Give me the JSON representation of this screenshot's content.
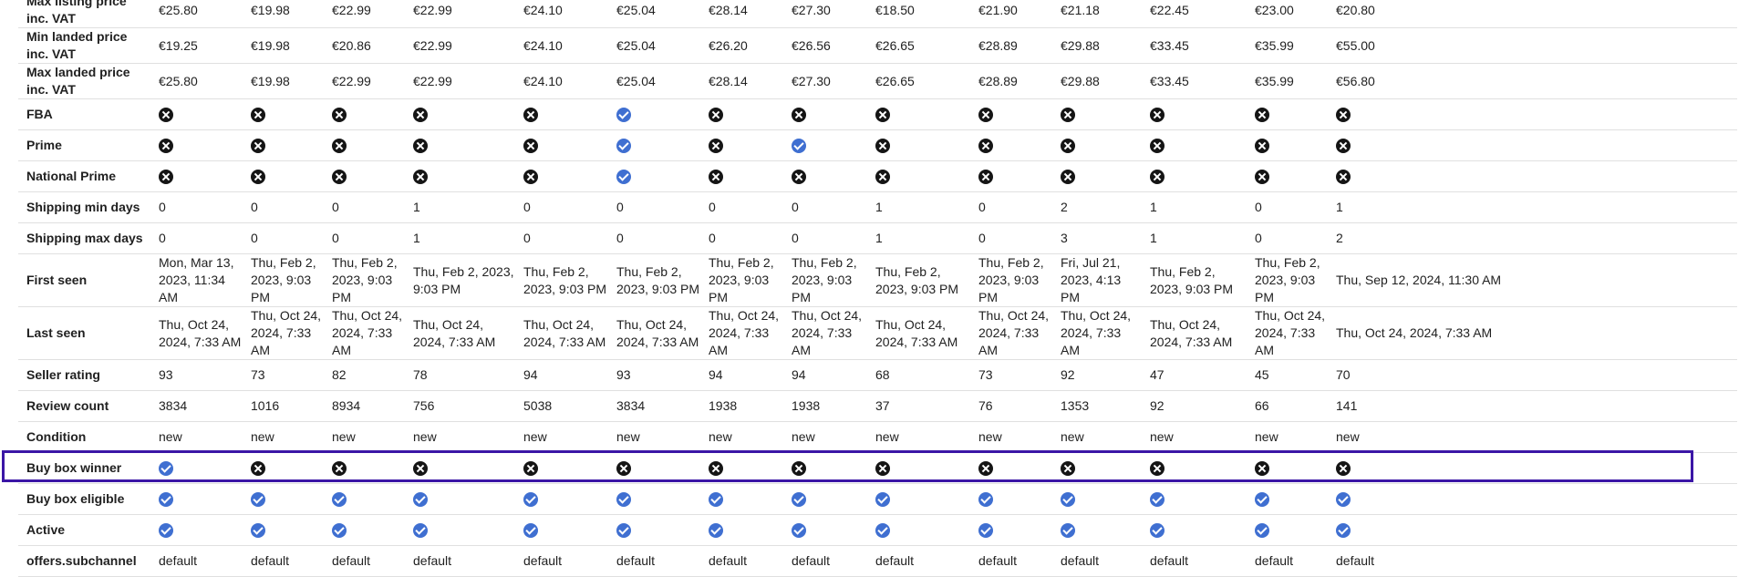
{
  "colors": {
    "check": "#3f6fd1",
    "cross": "#151515",
    "highlight": "#3b16a6"
  },
  "highlighted_row": "Buy box eligible",
  "rows": [
    {
      "label": "Max listing price inc. VAT",
      "type": "text",
      "cells": [
        "€25.80",
        "€19.98",
        "€22.99",
        "€22.99",
        "€24.10",
        "€25.04",
        "€28.14",
        "€27.30",
        "€18.50",
        "€21.90",
        "€21.18",
        "€22.45",
        "€23.00",
        "€20.80"
      ]
    },
    {
      "label": "Min landed price inc. VAT",
      "type": "text",
      "cells": [
        "€19.25",
        "€19.98",
        "€20.86",
        "€22.99",
        "€24.10",
        "€25.04",
        "€26.20",
        "€26.56",
        "€26.65",
        "€28.89",
        "€29.88",
        "€33.45",
        "€35.99",
        "€55.00"
      ]
    },
    {
      "label": "Max landed price inc. VAT",
      "type": "text",
      "cells": [
        "€25.80",
        "€19.98",
        "€22.99",
        "€22.99",
        "€24.10",
        "€25.04",
        "€28.14",
        "€27.30",
        "€26.65",
        "€28.89",
        "€29.88",
        "€33.45",
        "€35.99",
        "€56.80"
      ]
    },
    {
      "label": "FBA",
      "type": "icon",
      "cells": [
        "cross-icon",
        "cross-icon",
        "cross-icon",
        "cross-icon",
        "cross-icon",
        "check-icon",
        "cross-icon",
        "cross-icon",
        "cross-icon",
        "cross-icon",
        "cross-icon",
        "cross-icon",
        "cross-icon",
        "cross-icon"
      ]
    },
    {
      "label": "Prime",
      "type": "icon",
      "cells": [
        "cross-icon",
        "cross-icon",
        "cross-icon",
        "cross-icon",
        "cross-icon",
        "check-icon",
        "cross-icon",
        "check-icon",
        "cross-icon",
        "cross-icon",
        "cross-icon",
        "cross-icon",
        "cross-icon",
        "cross-icon"
      ]
    },
    {
      "label": "National Prime",
      "type": "icon",
      "cells": [
        "cross-icon",
        "cross-icon",
        "cross-icon",
        "cross-icon",
        "cross-icon",
        "check-icon",
        "cross-icon",
        "cross-icon",
        "cross-icon",
        "cross-icon",
        "cross-icon",
        "cross-icon",
        "cross-icon",
        "cross-icon"
      ]
    },
    {
      "label": "Shipping min days",
      "type": "text",
      "cells": [
        "0",
        "0",
        "0",
        "1",
        "0",
        "0",
        "0",
        "0",
        "1",
        "0",
        "2",
        "1",
        "0",
        "1"
      ]
    },
    {
      "label": "Shipping max days",
      "type": "text",
      "cells": [
        "0",
        "0",
        "0",
        "1",
        "0",
        "0",
        "0",
        "0",
        "1",
        "0",
        "3",
        "1",
        "0",
        "2"
      ]
    },
    {
      "label": "First seen",
      "type": "text",
      "tall": true,
      "cells": [
        "Mon, Mar 13, 2023, 11:34 AM",
        "Thu, Feb 2, 2023, 9:03 PM",
        "Thu, Feb 2, 2023, 9:03 PM",
        "Thu, Feb 2, 2023, 9:03 PM",
        "Thu, Feb 2, 2023, 9:03 PM",
        "Thu, Feb 2, 2023, 9:03 PM",
        "Thu, Feb 2, 2023, 9:03 PM",
        "Thu, Feb 2, 2023, 9:03 PM",
        "Thu, Feb 2, 2023, 9:03 PM",
        "Thu, Feb 2, 2023, 9:03 PM",
        "Fri, Jul 21, 2023, 4:13 PM",
        "Thu, Feb 2, 2023, 9:03 PM",
        "Thu, Feb 2, 2023, 9:03 PM",
        "Thu, Sep 12, 2024, 11:30 AM"
      ]
    },
    {
      "label": "Last seen",
      "type": "text",
      "tall": true,
      "cells": [
        "Thu, Oct 24, 2024, 7:33 AM",
        "Thu, Oct 24, 2024, 7:33 AM",
        "Thu, Oct 24, 2024, 7:33 AM",
        "Thu, Oct 24, 2024, 7:33 AM",
        "Thu, Oct 24, 2024, 7:33 AM",
        "Thu, Oct 24, 2024, 7:33 AM",
        "Thu, Oct 24, 2024, 7:33 AM",
        "Thu, Oct 24, 2024, 7:33 AM",
        "Thu, Oct 24, 2024, 7:33 AM",
        "Thu, Oct 24, 2024, 7:33 AM",
        "Thu, Oct 24, 2024, 7:33 AM",
        "Thu, Oct 24, 2024, 7:33 AM",
        "Thu, Oct 24, 2024, 7:33 AM",
        "Thu, Oct 24, 2024, 7:33 AM"
      ]
    },
    {
      "label": "Seller rating",
      "type": "text",
      "cells": [
        "93",
        "73",
        "82",
        "78",
        "94",
        "93",
        "94",
        "94",
        "68",
        "73",
        "92",
        "47",
        "45",
        "70"
      ]
    },
    {
      "label": "Review count",
      "type": "text",
      "cells": [
        "3834",
        "1016",
        "8934",
        "756",
        "5038",
        "3834",
        "1938",
        "1938",
        "37",
        "76",
        "1353",
        "92",
        "66",
        "141"
      ]
    },
    {
      "label": "Condition",
      "type": "text",
      "cells": [
        "new",
        "new",
        "new",
        "new",
        "new",
        "new",
        "new",
        "new",
        "new",
        "new",
        "new",
        "new",
        "new",
        "new"
      ]
    },
    {
      "label": "Buy box winner",
      "type": "icon",
      "cells": [
        "check-icon",
        "cross-icon",
        "cross-icon",
        "cross-icon",
        "cross-icon",
        "cross-icon",
        "cross-icon",
        "cross-icon",
        "cross-icon",
        "cross-icon",
        "cross-icon",
        "cross-icon",
        "cross-icon",
        "cross-icon"
      ]
    },
    {
      "label": "Buy box eligible",
      "type": "icon",
      "cells": [
        "check-icon",
        "check-icon",
        "check-icon",
        "check-icon",
        "check-icon",
        "check-icon",
        "check-icon",
        "check-icon",
        "check-icon",
        "check-icon",
        "check-icon",
        "check-icon",
        "check-icon",
        "check-icon"
      ]
    },
    {
      "label": "Active",
      "type": "icon",
      "cells": [
        "check-icon",
        "check-icon",
        "check-icon",
        "check-icon",
        "check-icon",
        "check-icon",
        "check-icon",
        "check-icon",
        "check-icon",
        "check-icon",
        "check-icon",
        "check-icon",
        "check-icon",
        "check-icon"
      ]
    },
    {
      "label": "offers.subchannel",
      "type": "text",
      "cells": [
        "default",
        "default",
        "default",
        "default",
        "default",
        "default",
        "default",
        "default",
        "default",
        "default",
        "default",
        "default",
        "default",
        "default"
      ]
    }
  ]
}
